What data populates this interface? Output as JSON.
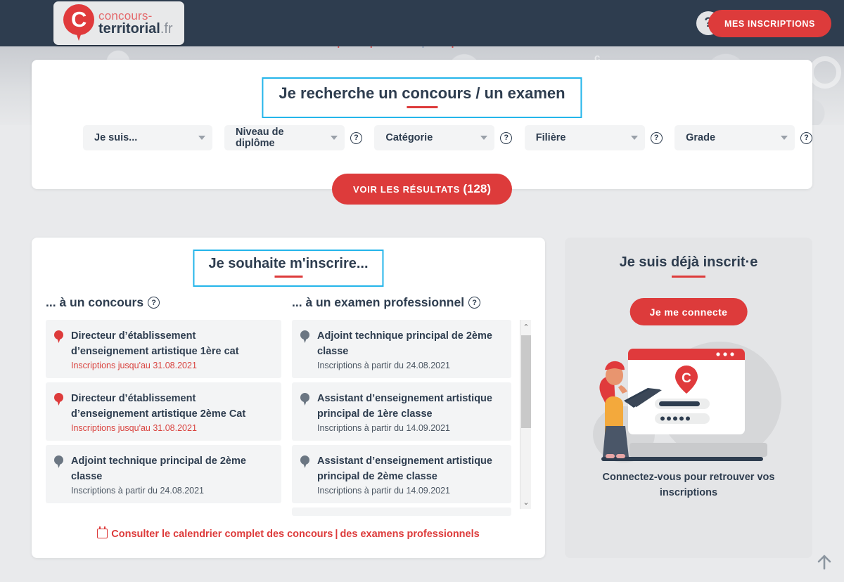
{
  "header": {
    "logo": {
      "line1": "concours-",
      "line2_bold": "territorial",
      "line2_light": ".fr",
      "monogram": "C"
    },
    "help_label": "?",
    "inscriptions_button": "MES INSCRIPTIONS"
  },
  "subnav": {
    "item1": "Pourquoi ce portail ?",
    "separator": "|",
    "item2": "À qui s'adresse-t-il ?"
  },
  "search": {
    "title": "Je recherche un concours / un examen",
    "filters": [
      {
        "label": "Je suis...",
        "has_help": false
      },
      {
        "label": "Niveau de diplôme",
        "has_help": true
      },
      {
        "label": "Catégorie",
        "has_help": true
      },
      {
        "label": "Filière",
        "has_help": true
      },
      {
        "label": "Grade",
        "has_help": true
      }
    ],
    "results_button": "VOIR LES RÉSULTATS",
    "results_count": "(128)"
  },
  "inscrire": {
    "title": "Je souhaite m'inscrire...",
    "concours": {
      "heading": "... à un concours",
      "help": "?",
      "items": [
        {
          "name": "Directeur d’établissement d’enseignement artistique 1ère cat",
          "date": "Inscriptions jusqu'au 31.08.2021",
          "date_style": "red",
          "pin": "red"
        },
        {
          "name": "Directeur d’établissement d’enseignement artistique 2ème Cat",
          "date": "Inscriptions jusqu'au 31.08.2021",
          "date_style": "red",
          "pin": "red"
        },
        {
          "name": "Adjoint technique principal de 2ème classe",
          "date": "Inscriptions à partir du 24.08.2021",
          "date_style": "gray",
          "pin": "gray"
        }
      ]
    },
    "examens": {
      "heading": "... à un examen professionnel",
      "help": "?",
      "items": [
        {
          "name": "Adjoint technique principal de 2ème classe",
          "date": "Inscriptions à partir du 24.08.2021",
          "date_style": "gray",
          "pin": "gray"
        },
        {
          "name": "Assistant d’enseignement artistique principal de 1ère classe",
          "date": "Inscriptions à partir du 14.09.2021",
          "date_style": "gray",
          "pin": "gray"
        },
        {
          "name": "Assistant d’enseignement artistique principal de 2ème classe",
          "date": "Inscriptions à partir du 14.09.2021",
          "date_style": "gray",
          "pin": "gray"
        }
      ],
      "scroll_up": "⌃",
      "scroll_down": "⌄"
    },
    "calendar_link_1": "Consulter le calendrier complet des concours",
    "calendar_separator": "|",
    "calendar_link_2": "des examens professionnels"
  },
  "already": {
    "title": "Je suis déjà inscrit·e",
    "connect_button": "Je me connecte",
    "footer": "Connectez-vous pour retrouver vos inscriptions"
  },
  "colors": {
    "brand_red": "#dd3b3b",
    "dark_navy": "#2e3d4f",
    "accent_cyan": "#24b5ea",
    "panel_gray": "#e4e5e7",
    "item_gray": "#f3f4f5"
  },
  "scroll_top_icon": "↑"
}
